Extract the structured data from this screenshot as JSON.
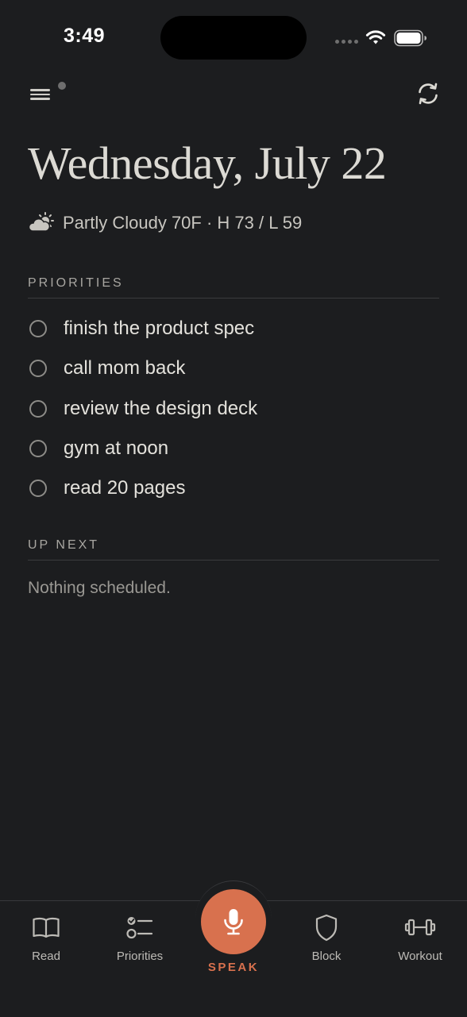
{
  "status_bar": {
    "time": "3:49"
  },
  "header": {
    "date": "Wednesday, July 22"
  },
  "weather": {
    "icon": "partly-cloudy-icon",
    "text": "Partly Cloudy 70F · H 73 / L 59"
  },
  "priorities": {
    "header": "PRIORITIES",
    "items": [
      {
        "label": "finish the product spec",
        "done": false
      },
      {
        "label": "call mom back",
        "done": false
      },
      {
        "label": "review the design deck",
        "done": false
      },
      {
        "label": "gym at noon",
        "done": false
      },
      {
        "label": "read 20 pages",
        "done": false
      }
    ]
  },
  "up_next": {
    "header": "UP NEXT",
    "empty_text": "Nothing scheduled."
  },
  "tab_bar": {
    "read": "Read",
    "priorities": "Priorities",
    "speak": "SPEAK",
    "block": "Block",
    "workout": "Workout"
  },
  "colors": {
    "background": "#1c1d1f",
    "accent": "#d8714e",
    "text": "#e6e4df",
    "muted": "#9a9893"
  }
}
